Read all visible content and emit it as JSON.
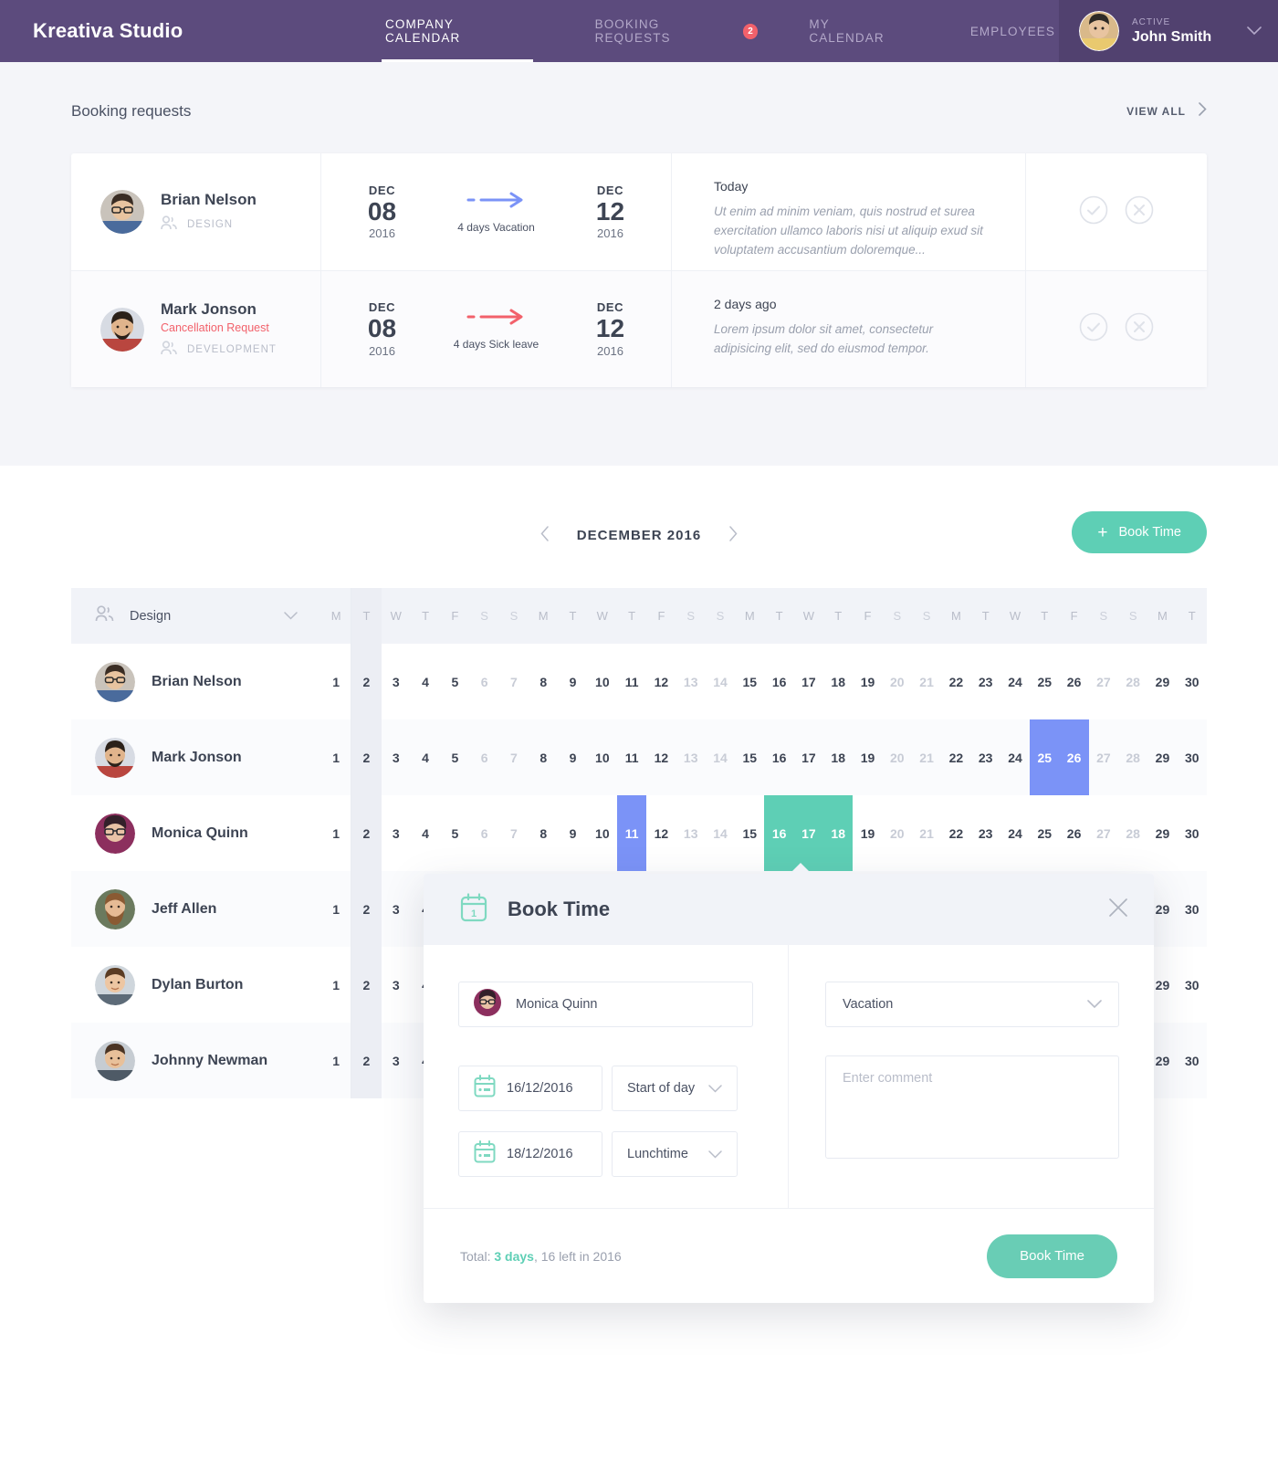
{
  "brand": "Kreativa Studio",
  "nav": {
    "items": [
      {
        "label": "COMPANY CALENDAR",
        "active": true,
        "badge": ""
      },
      {
        "label": "BOOKING REQUESTS",
        "active": false,
        "badge": "2"
      },
      {
        "label": "MY CALENDAR",
        "active": false,
        "badge": ""
      },
      {
        "label": "EMPLOYEES",
        "active": false,
        "badge": ""
      }
    ]
  },
  "user": {
    "status": "ACTIVE",
    "name": "John Smith",
    "caret": "chevron-down-icon"
  },
  "requests": {
    "title": "Booking requests",
    "view_all": "VIEW ALL",
    "rows": [
      {
        "name": "Brian Nelson",
        "sub": "",
        "dept": "DESIGN",
        "from_month": "DEC",
        "from_day": "08",
        "from_year": "2016",
        "to_month": "DEC",
        "to_day": "12",
        "to_year": "2016",
        "duration": "4 days Vacation",
        "accent": "#7b93f7",
        "when": "Today",
        "note": "Ut enim ad minim veniam, quis nostrud et surea exercitation ullamco laboris nisi ut aliquip exud sit voluptatem accusantium doloremque..."
      },
      {
        "name": "Mark Jonson",
        "sub": "Cancellation Request",
        "dept": "DEVELOPMENT",
        "from_month": "DEC",
        "from_day": "08",
        "from_year": "2016",
        "to_month": "DEC",
        "to_day": "12",
        "to_year": "2016",
        "duration": "4 days Sick leave",
        "accent": "#f2616b",
        "when": "2 days ago",
        "note": "Lorem ipsum dolor sit amet, consectetur adipisicing elit, sed do eiusmod tempor."
      }
    ]
  },
  "calendar": {
    "month_label": "DECEMBER 2016",
    "prev": "chevron-left-icon",
    "next": "chevron-right-icon",
    "book_time_button": "Book Time",
    "group": "Design",
    "weekdays": [
      "M",
      "T",
      "W",
      "T",
      "F",
      "S",
      "S",
      "M",
      "T",
      "W",
      "T",
      "F",
      "S",
      "S",
      "M",
      "T",
      "W",
      "T",
      "F",
      "S",
      "S",
      "M",
      "T",
      "W",
      "T",
      "F",
      "S",
      "S",
      "M",
      "T"
    ],
    "days": [
      1,
      2,
      3,
      4,
      5,
      6,
      7,
      8,
      9,
      10,
      11,
      12,
      13,
      14,
      15,
      16,
      17,
      18,
      19,
      20,
      21,
      22,
      23,
      24,
      25,
      26,
      27,
      28,
      29,
      30
    ],
    "weekend_days": [
      6,
      7,
      13,
      14,
      20,
      21,
      27,
      28
    ],
    "today_index": 1,
    "employees": [
      {
        "name": "Brian Nelson",
        "bookings": []
      },
      {
        "name": "Mark Jonson",
        "bookings": [
          {
            "start": 25,
            "end": 26,
            "color": "blue"
          }
        ]
      },
      {
        "name": "Monica Quinn",
        "bookings": [
          {
            "start": 11,
            "end": 11,
            "color": "blue"
          },
          {
            "start": 16,
            "end": 18,
            "color": "teal"
          }
        ]
      },
      {
        "name": "Jeff Allen",
        "bookings": []
      },
      {
        "name": "Dylan Burton",
        "bookings": []
      },
      {
        "name": "Johnny Newman",
        "bookings": []
      }
    ]
  },
  "modal": {
    "title": "Book Time",
    "close": "close-icon",
    "employee": "Monica Quinn",
    "leave_type": "Vacation",
    "date_from": "16/12/2016",
    "time_from": "Start of day",
    "date_to": "18/12/2016",
    "time_to": "Lunchtime",
    "comment_placeholder": "Enter comment",
    "total_prefix": "Total: ",
    "total_days": "3 days",
    "total_suffix": ", 16 left in 2016",
    "submit": "Book Time"
  },
  "colors": {
    "brand_purple": "#5c4b7d",
    "accent_teal": "#5ecfb5",
    "accent_blue": "#7b93f7",
    "accent_red": "#f2616b"
  }
}
